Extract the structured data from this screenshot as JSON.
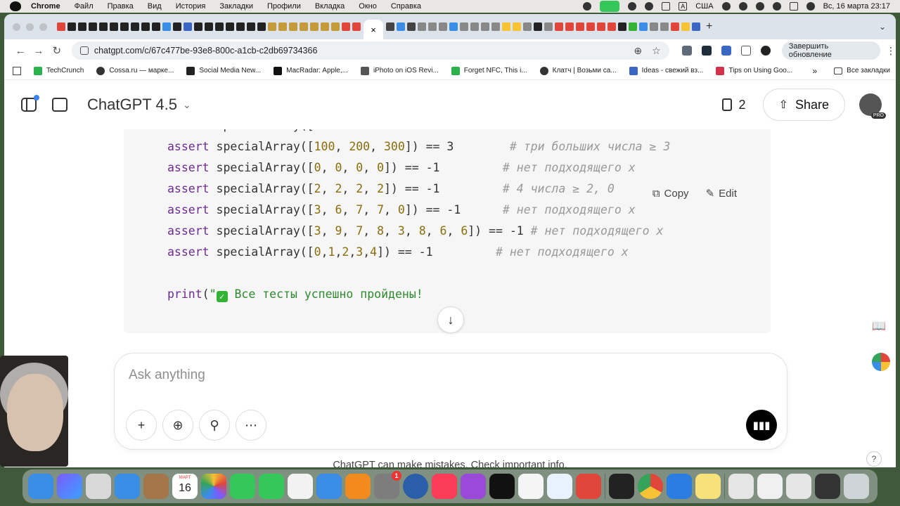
{
  "menubar": {
    "app": "Chrome",
    "items": [
      "Файл",
      "Правка",
      "Вид",
      "История",
      "Закладки",
      "Профили",
      "Вкладка",
      "Окно",
      "Справка"
    ],
    "lang": "США",
    "datetime": "Вс, 16 марта 23:17"
  },
  "browser": {
    "active_tab_close": "×",
    "new_tab": "+",
    "url": "chatgpt.com/c/67c477be-93e8-800c-a1cb-c2db69734366",
    "update_button": "Завершить обновление",
    "bookmarks": [
      {
        "label": "TechCrunch",
        "color": "#2bb24c"
      },
      {
        "label": "Cossa.ru — марке...",
        "color": "#333333"
      },
      {
        "label": "Social Media New...",
        "color": "#222222"
      },
      {
        "label": "MacRadar: Apple,...",
        "color": "#111111"
      },
      {
        "label": "iPhoto on iOS Revi...",
        "color": "#555555"
      },
      {
        "label": "Forget NFC, This i...",
        "color": "#2bb24c"
      },
      {
        "label": "Клатч | Возьми са...",
        "color": "#333333"
      },
      {
        "label": "Ideas - свежий вз...",
        "color": "#3a66c4"
      },
      {
        "label": "Tips on Using Goo...",
        "color": "#d0334a"
      }
    ],
    "bookmarks_more": "»",
    "all_bookmarks": "Все закладки"
  },
  "chat": {
    "model": "ChatGPT 4.5",
    "doc_count": "2",
    "share_label": "Share",
    "avatar_badge": "PRO",
    "code_actions": {
      "copy": "Copy",
      "edit": "Edit"
    },
    "code_lines": [
      {
        "kw": "assert",
        "call": "specialArray([",
        "args": [
          "100",
          "200",
          "300"
        ],
        "tail": "]) == ",
        "result": "3",
        "pad": "        ",
        "comment": "# три больших числа ≥ 3"
      },
      {
        "kw": "assert",
        "call": "specialArray([",
        "args": [
          "0",
          "0",
          "0",
          "0"
        ],
        "tail": "]) == ",
        "result": "-1",
        "pad": "         ",
        "comment": "# нет подходящего x"
      },
      {
        "kw": "assert",
        "call": "specialArray([",
        "args": [
          "2",
          "2",
          "2",
          "2"
        ],
        "tail": "]) == ",
        "result": "-1",
        "pad": "         ",
        "comment": "# 4 числа ≥ 2, 0"
      },
      {
        "kw": "assert",
        "call": "specialArray([",
        "args": [
          "3",
          "6",
          "7",
          "7",
          "0"
        ],
        "tail": "]) == ",
        "result": "-1",
        "pad": "      ",
        "comment": "# нет подходящего x"
      },
      {
        "kw": "assert",
        "call": "specialArray([",
        "args": [
          "3",
          "9",
          "7",
          "8",
          "3",
          "8",
          "6",
          "6"
        ],
        "tail": "]) == ",
        "result": "-1",
        "pad": " ",
        "comment": "# нет подходящего x"
      },
      {
        "kw": "assert",
        "call": "specialArray([",
        "args_compact": "0,1,2,3,4",
        "tail": "]) == ",
        "result": "-1",
        "pad": "         ",
        "comment": "# нет подходящего x"
      }
    ],
    "print_line": {
      "fn": "print(",
      "string": "\" Все тесты успешно пройдены!"
    },
    "composer_placeholder": "Ask anything",
    "disclaimer": "ChatGPT can make mistakes. Check important info.",
    "help": "?"
  },
  "dock": {
    "calendar_day": "16",
    "appstore_badge": "1"
  }
}
